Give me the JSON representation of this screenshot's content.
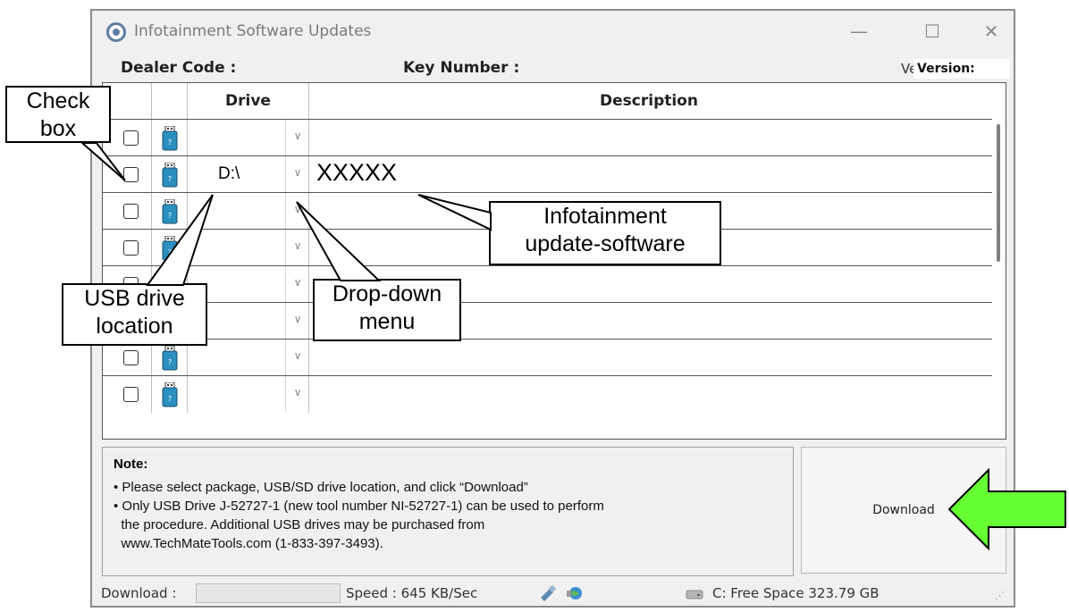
{
  "window": {
    "title": "Infotainment Software Updates",
    "controls": [
      "—",
      "☐",
      "✕"
    ]
  },
  "header": {
    "dealer_label": "Dealer Code :",
    "key_label": "Key Number :",
    "version_prefix": "Ve",
    "version_label": "Version:"
  },
  "grid": {
    "columns": [
      "",
      "",
      "Drive",
      "Description"
    ],
    "rows": [
      {
        "drive": "",
        "description": ""
      },
      {
        "drive": "D:\\",
        "description": "XXXXX"
      },
      {
        "drive": "",
        "description": ""
      },
      {
        "drive": "",
        "description": ""
      },
      {
        "drive": "",
        "description": ""
      },
      {
        "drive": "",
        "description": ""
      },
      {
        "drive": "",
        "description": ""
      },
      {
        "drive": "",
        "description": ""
      }
    ]
  },
  "note": {
    "title": "Note:",
    "lines": [
      "• Please select package, USB/SD drive location, and click “Download”",
      "• Only USB Drive J-52727-1 (new tool number NI-52727-1) can be used to perform",
      "  the procedure. Additional USB drives may be purchased from",
      "  www.TechMateTools.com (1-833-397-3493)."
    ]
  },
  "download_button": "Download",
  "status": {
    "download_label": "Download :",
    "speed": "Speed :  645 KB/Sec",
    "free_space": "C: Free Space 323.79 GB"
  },
  "callouts": {
    "check_box": [
      "Check",
      "box"
    ],
    "usb_drive": [
      "USB drive",
      "location"
    ],
    "drop_down": [
      "Drop-down",
      "menu"
    ],
    "infotainment": [
      "Infotainment",
      "update-software"
    ]
  },
  "colors": {
    "arrow_fill": "#66ff33",
    "usb_icon": "#2b8fbf",
    "window_bg": "#f0f0f0"
  }
}
